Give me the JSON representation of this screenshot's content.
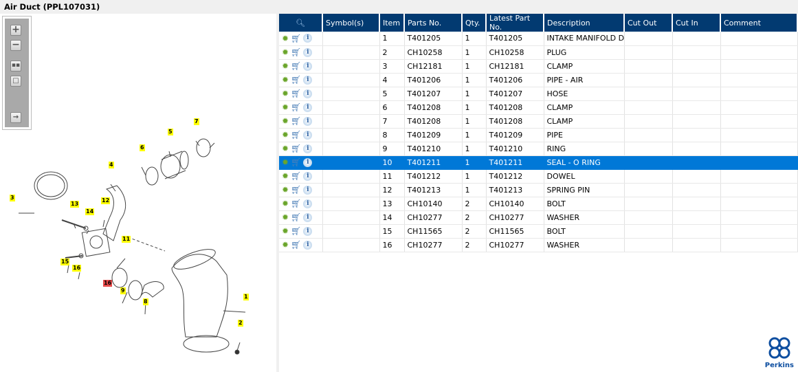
{
  "title": "Air Duct (PPL107031)",
  "toolbar": {
    "zoom_in": "+",
    "zoom_out": "−"
  },
  "callouts": [
    "7",
    "5",
    "6",
    "4",
    "3",
    "13",
    "12",
    "14",
    "11",
    "15",
    "16",
    "16",
    "9",
    "8",
    "1",
    "2"
  ],
  "table": {
    "headers": [
      "Symbol(s)",
      "Item",
      "Parts No.",
      "Qty.",
      "Latest Part No.",
      "Description",
      "Cut Out",
      "Cut In",
      "Comment"
    ],
    "selected_item": "10",
    "rows": [
      [
        "",
        "1",
        "T401205",
        "1",
        "T401205",
        "INTAKE MANIFOLD DU",
        "",
        "",
        ""
      ],
      [
        "",
        "2",
        "CH10258",
        "1",
        "CH10258",
        "PLUG",
        "",
        "",
        ""
      ],
      [
        "",
        "3",
        "CH12181",
        "1",
        "CH12181",
        "CLAMP",
        "",
        "",
        ""
      ],
      [
        "",
        "4",
        "T401206",
        "1",
        "T401206",
        "PIPE - AIR",
        "",
        "",
        ""
      ],
      [
        "",
        "5",
        "T401207",
        "1",
        "T401207",
        "HOSE",
        "",
        "",
        ""
      ],
      [
        "",
        "6",
        "T401208",
        "1",
        "T401208",
        "CLAMP",
        "",
        "",
        ""
      ],
      [
        "",
        "7",
        "T401208",
        "1",
        "T401208",
        "CLAMP",
        "",
        "",
        ""
      ],
      [
        "",
        "8",
        "T401209",
        "1",
        "T401209",
        "PIPE",
        "",
        "",
        ""
      ],
      [
        "",
        "9",
        "T401210",
        "1",
        "T401210",
        "RING",
        "",
        "",
        ""
      ],
      [
        "",
        "10",
        "T401211",
        "1",
        "T401211",
        "SEAL - O RING",
        "",
        "",
        ""
      ],
      [
        "",
        "11",
        "T401212",
        "1",
        "T401212",
        "DOWEL",
        "",
        "",
        ""
      ],
      [
        "",
        "12",
        "T401213",
        "1",
        "T401213",
        "SPRING PIN",
        "",
        "",
        ""
      ],
      [
        "",
        "13",
        "CH10140",
        "2",
        "CH10140",
        "BOLT",
        "",
        "",
        ""
      ],
      [
        "",
        "14",
        "CH10277",
        "2",
        "CH10277",
        "WASHER",
        "",
        "",
        ""
      ],
      [
        "",
        "15",
        "CH11565",
        "2",
        "CH11565",
        "BOLT",
        "",
        "",
        ""
      ],
      [
        "",
        "16",
        "CH10277",
        "2",
        "CH10277",
        "WASHER",
        "",
        "",
        ""
      ]
    ]
  },
  "logo": "Perkins"
}
